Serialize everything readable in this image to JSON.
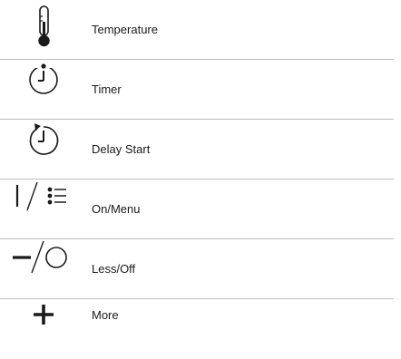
{
  "legend": {
    "rows": [
      {
        "icon": "thermometer-icon",
        "label": "Temperature"
      },
      {
        "icon": "timer-icon",
        "label": "Timer"
      },
      {
        "icon": "delay-start-icon",
        "label": "Delay Start"
      },
      {
        "icon": "on-menu-icon",
        "label": "On/Menu"
      },
      {
        "icon": "less-off-icon",
        "label": "Less/Off"
      },
      {
        "icon": "plus-icon",
        "label": "More"
      }
    ]
  },
  "colors": {
    "icon": "#1a1a1a",
    "divider": "#bdbdbd",
    "text": "#1a1a1a"
  }
}
